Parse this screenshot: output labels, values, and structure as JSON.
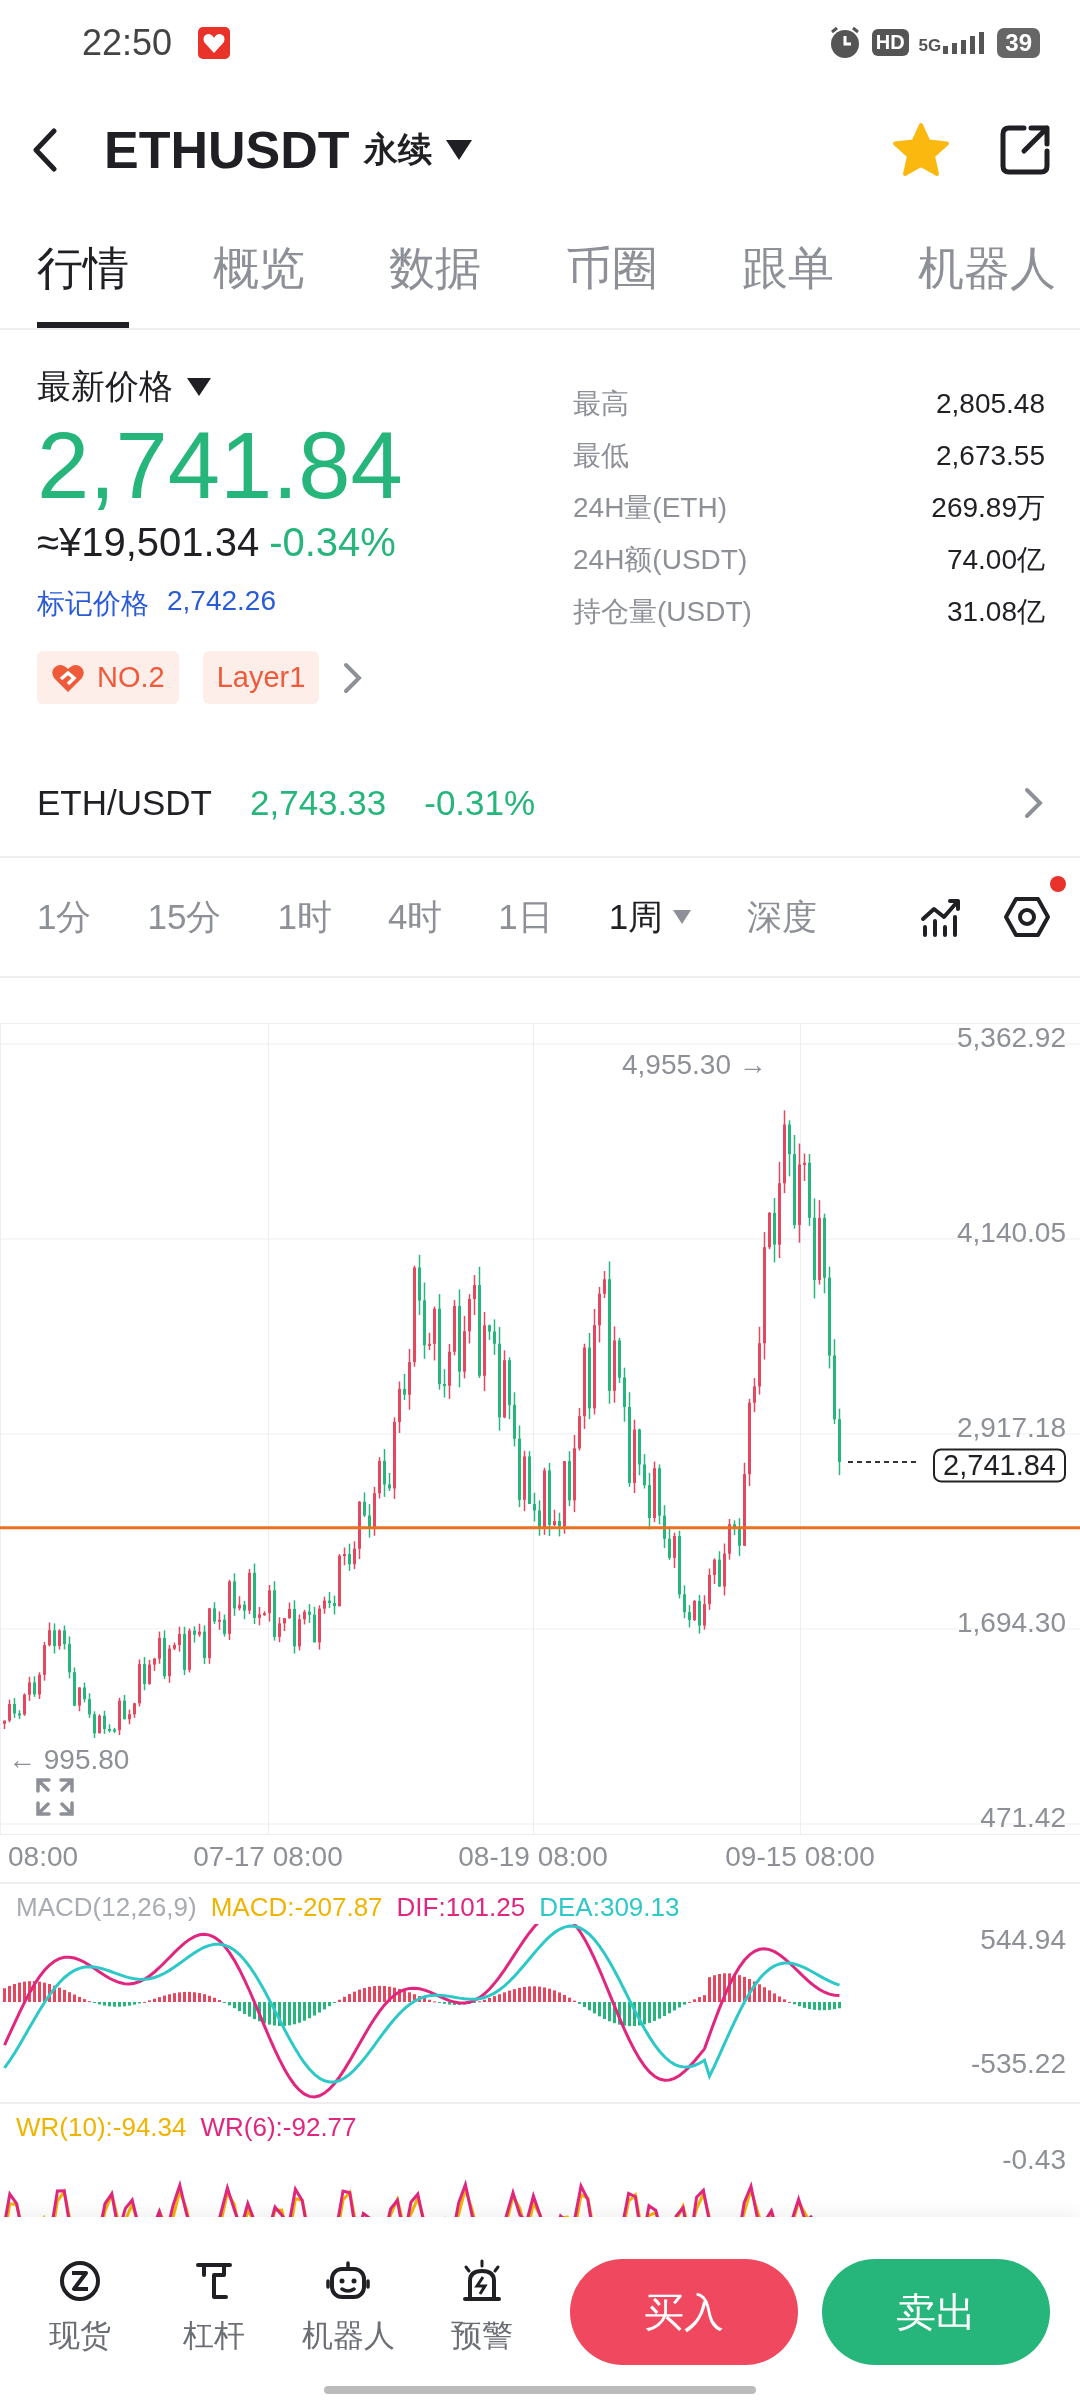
{
  "status_bar": {
    "time": "22:50",
    "hd": "HD",
    "network": "5G",
    "battery": "39"
  },
  "header": {
    "symbol": "ETHUSDT",
    "contract_type": "永续",
    "favorited": true
  },
  "tabs": [
    {
      "label": "行情",
      "selected": true
    },
    {
      "label": "概览",
      "selected": false
    },
    {
      "label": "数据",
      "selected": false
    },
    {
      "label": "币圈",
      "selected": false
    },
    {
      "label": "跟单",
      "selected": false
    },
    {
      "label": "机器人",
      "selected": false
    }
  ],
  "price": {
    "label": "最新价格",
    "last": "2,741.84",
    "cny": "≈¥19,501.34",
    "change": "-0.34%",
    "mark_label": "标记价格",
    "mark": "2,742.26",
    "tags": [
      {
        "label": "NO.2",
        "kind": "rank"
      },
      {
        "label": "Layer1",
        "kind": "sector"
      }
    ]
  },
  "stats": [
    {
      "label": "最高",
      "value": "2,805.48"
    },
    {
      "label": "最低",
      "value": "2,673.55"
    },
    {
      "label": "24H量(ETH)",
      "value": "269.89万"
    },
    {
      "label": "24H额(USDT)",
      "value": "74.00亿"
    },
    {
      "label": "持仓量(USDT)",
      "value": "31.08亿"
    }
  ],
  "spot": {
    "pair": "ETH/USDT",
    "price": "2,743.33",
    "change": "-0.31%"
  },
  "intervals": [
    {
      "label": "1分",
      "selected": false
    },
    {
      "label": "15分",
      "selected": false
    },
    {
      "label": "1时",
      "selected": false
    },
    {
      "label": "4时",
      "selected": false
    },
    {
      "label": "1日",
      "selected": false
    },
    {
      "label": "1周",
      "selected": true
    },
    {
      "label": "深度",
      "selected": false
    }
  ],
  "settings_badge": true,
  "chart": {
    "y_labels": [
      "5,362.92",
      "4,140.05",
      "2,917.18",
      "1,694.30",
      "471.42"
    ],
    "x_labels": [
      "08:00",
      "07-17 08:00",
      "08-19 08:00",
      "09-15 08:00"
    ],
    "high_marker": "4,955.30 →",
    "low_marker": "← 995.80",
    "current_price": "2,741.84"
  },
  "macd": {
    "title": "MACD(12,26,9)",
    "legend": [
      {
        "text": "MACD:-207.87",
        "color": "#f0b400"
      },
      {
        "text": "DIF:101.25",
        "color": "#e0267e"
      },
      {
        "text": "DEA:309.13",
        "color": "#2ec8c8"
      }
    ],
    "y_labels": [
      "544.94",
      "-535.22"
    ]
  },
  "wr": {
    "legend": [
      {
        "text": "WR(10):-94.34",
        "color": "#f0b400"
      },
      {
        "text": "WR(6):-92.77",
        "color": "#e0267e"
      }
    ],
    "y_labels": [
      "-0.43"
    ]
  },
  "bottom_nav": [
    {
      "label": "现货",
      "kind": "spot"
    },
    {
      "label": "杠杆",
      "kind": "margin"
    },
    {
      "label": "机器人",
      "kind": "bot"
    },
    {
      "label": "预警",
      "kind": "alert"
    }
  ],
  "actions": [
    {
      "label": "买入",
      "kind": "buy"
    },
    {
      "label": "卖出",
      "kind": "sell"
    }
  ]
}
